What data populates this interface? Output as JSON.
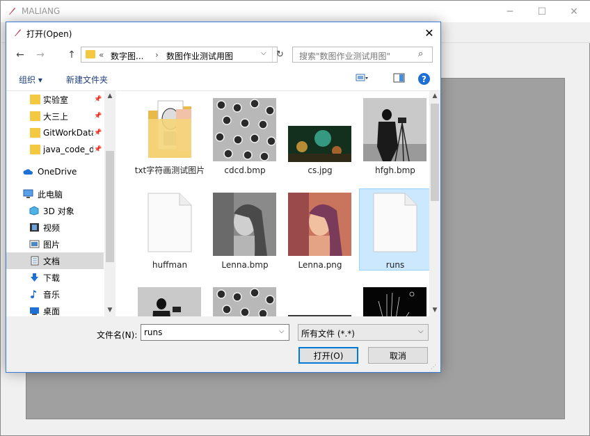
{
  "app": {
    "title": "MALIANG",
    "minimize_icon": "minimize-icon",
    "maximize_icon": "maximize-icon",
    "close_icon": "close-icon",
    "canvas_color": "#a0a0a0"
  },
  "dialog": {
    "title": "打开(Open)",
    "close_glyph": "✕",
    "nav": {
      "back_glyph": "←",
      "forward_glyph": "→",
      "up_glyph": "↑"
    },
    "address": {
      "overflow": "«",
      "crumb1": "数字图...",
      "separator": "›",
      "crumb2": "数图作业测试用图",
      "dropdown_glyph": "⌵",
      "refresh_glyph": "↻"
    },
    "search": {
      "placeholder": "搜索\"数图作业测试用图\"",
      "icon_glyph": "⌕"
    },
    "commands": {
      "organize": "组织 ▾",
      "new_folder": "新建文件夹",
      "help": "?"
    },
    "sidebar": {
      "items": [
        {
          "label": "实验室",
          "icon": "folder-icon",
          "pinned": true
        },
        {
          "label": "大三上",
          "icon": "folder-icon",
          "pinned": true
        },
        {
          "label": "GitWorkData",
          "icon": "folder-icon",
          "pinned": true
        },
        {
          "label": "java_code_d",
          "icon": "folder-icon",
          "pinned": true
        },
        {
          "label": "OneDrive",
          "icon": "cloud-icon",
          "pinned": false
        },
        {
          "label": "此电脑",
          "icon": "computer-icon",
          "pinned": false
        },
        {
          "label": "3D 对象",
          "icon": "cube-icon",
          "pinned": false
        },
        {
          "label": "视频",
          "icon": "video-icon",
          "pinned": false
        },
        {
          "label": "图片",
          "icon": "pictures-icon",
          "pinned": false
        },
        {
          "label": "文档",
          "icon": "documents-icon",
          "pinned": false
        },
        {
          "label": "下载",
          "icon": "download-icon",
          "pinned": false
        },
        {
          "label": "音乐",
          "icon": "music-icon",
          "pinned": false
        },
        {
          "label": "桌面",
          "icon": "desktop-icon",
          "pinned": false
        }
      ],
      "pin_glyph": "📌",
      "active_item": "文档"
    },
    "files": [
      {
        "name": "txt字符画测试图片",
        "kind": "folder"
      },
      {
        "name": "cdcd.bmp",
        "kind": "image"
      },
      {
        "name": "cs.jpg",
        "kind": "image"
      },
      {
        "name": "hfgh.bmp",
        "kind": "image"
      },
      {
        "name": "huffman",
        "kind": "file"
      },
      {
        "name": "Lenna.bmp",
        "kind": "image"
      },
      {
        "name": "Lenna.png",
        "kind": "image"
      },
      {
        "name": "runs",
        "kind": "file",
        "selected": true
      },
      {
        "name": "",
        "kind": "image"
      },
      {
        "name": "",
        "kind": "image"
      },
      {
        "name": "",
        "kind": "image"
      },
      {
        "name": "",
        "kind": "image"
      }
    ],
    "filename": {
      "label": "文件名(N):",
      "value": "runs"
    },
    "filetype": {
      "value": "所有文件 (*.*)"
    },
    "buttons": {
      "open": "打开(O)",
      "cancel": "取消"
    },
    "accent_color": "#0078d7",
    "selection_color": "#cce8ff"
  }
}
